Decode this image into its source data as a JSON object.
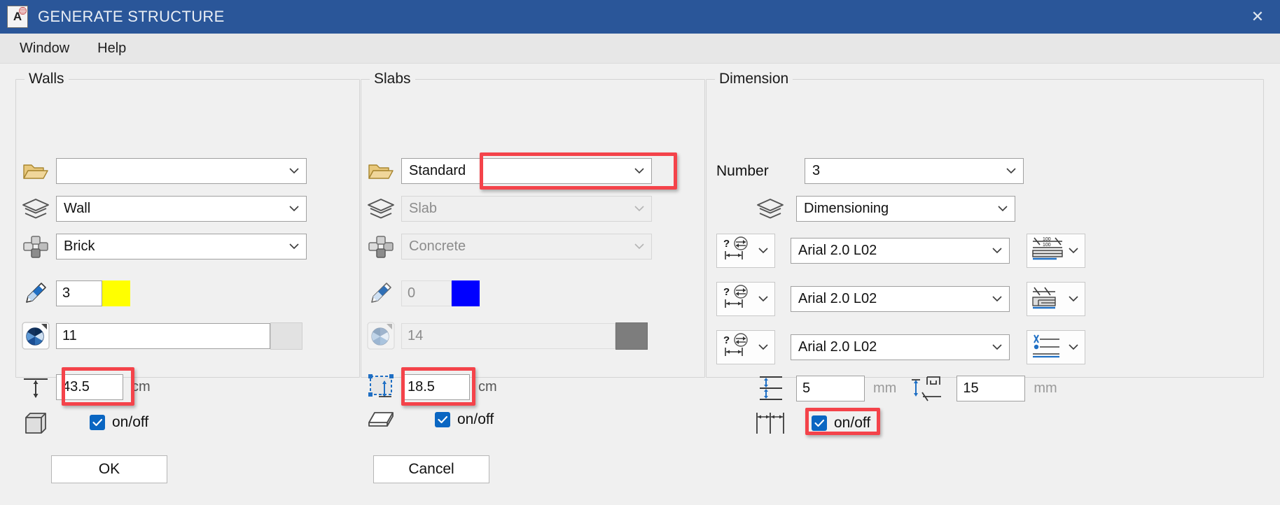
{
  "titlebar": {
    "title": "GENERATE STRUCTURE",
    "app_icon": "document-a-icon",
    "close_label": "✕",
    "background": "#2a5699"
  },
  "menubar": {
    "items": [
      {
        "label": "Window"
      },
      {
        "label": "Help"
      }
    ]
  },
  "walls": {
    "legend": "Walls",
    "folder": {
      "icon": "open-folder-icon",
      "value": "",
      "enabled": true
    },
    "layer": {
      "icon": "layers-icon",
      "value": "Wall",
      "enabled": true
    },
    "material": {
      "icon": "component-cross-icon",
      "value": "Brick",
      "enabled": true
    },
    "pen": {
      "icon": "pencil-icon",
      "value": "3",
      "color": "#ffff00",
      "enabled": true
    },
    "hatch": {
      "icon": "pie-hatch-icon",
      "value": "11",
      "enabled": true
    },
    "thickness": {
      "icon": "height-arrow-icon",
      "value": "43.5",
      "unit": "cm",
      "enabled": true
    },
    "toggle": {
      "icon": "box-3d-icon",
      "label": "on/off",
      "checked": true
    }
  },
  "slabs": {
    "legend": "Slabs",
    "folder": {
      "icon": "open-folder-icon",
      "value": "Standard",
      "enabled": true
    },
    "layer": {
      "icon": "layers-icon",
      "value": "Slab",
      "enabled": false
    },
    "material": {
      "icon": "component-cross-icon",
      "value": "Concrete",
      "enabled": false
    },
    "pen": {
      "icon": "pencil-icon",
      "value": "0",
      "color": "#0000ff",
      "enabled": false
    },
    "hatch": {
      "icon": "pie-hatch-icon",
      "value": "14",
      "enabled": false
    },
    "thickness": {
      "icon": "area-select-icon",
      "value": "18.5",
      "unit": "cm",
      "enabled": true
    },
    "toggle": {
      "icon": "slab-flat-icon",
      "label": "on/off",
      "checked": true
    }
  },
  "dimension": {
    "legend": "Dimension",
    "number": {
      "label": "Number",
      "value": "3"
    },
    "layer": {
      "icon": "layers-icon",
      "value": "Dimensioning"
    },
    "styles": [
      {
        "icon": "dim-style-question-icon",
        "value": "Arial 2.0 L02",
        "placement_icon": "dim-placement-100-icon"
      },
      {
        "icon": "dim-style-question-icon",
        "value": "Arial 2.0 L02",
        "placement_icon": "dim-placement-step-icon"
      },
      {
        "icon": "dim-style-question-icon",
        "value": "Arial 2.0 L02",
        "placement_icon": "dim-placement-line-icon"
      }
    ],
    "spacing": {
      "icon": "line-spacing-icon",
      "value": "5",
      "unit": "mm"
    },
    "offset": {
      "icon": "text-offset-icon",
      "value": "15",
      "unit": "mm"
    },
    "toggle": {
      "icon": "dim-extent-icon",
      "label": "on/off",
      "checked": true
    }
  },
  "footer": {
    "ok_label": "OK",
    "cancel_label": "Cancel"
  },
  "highlight_color": "#f4434a"
}
